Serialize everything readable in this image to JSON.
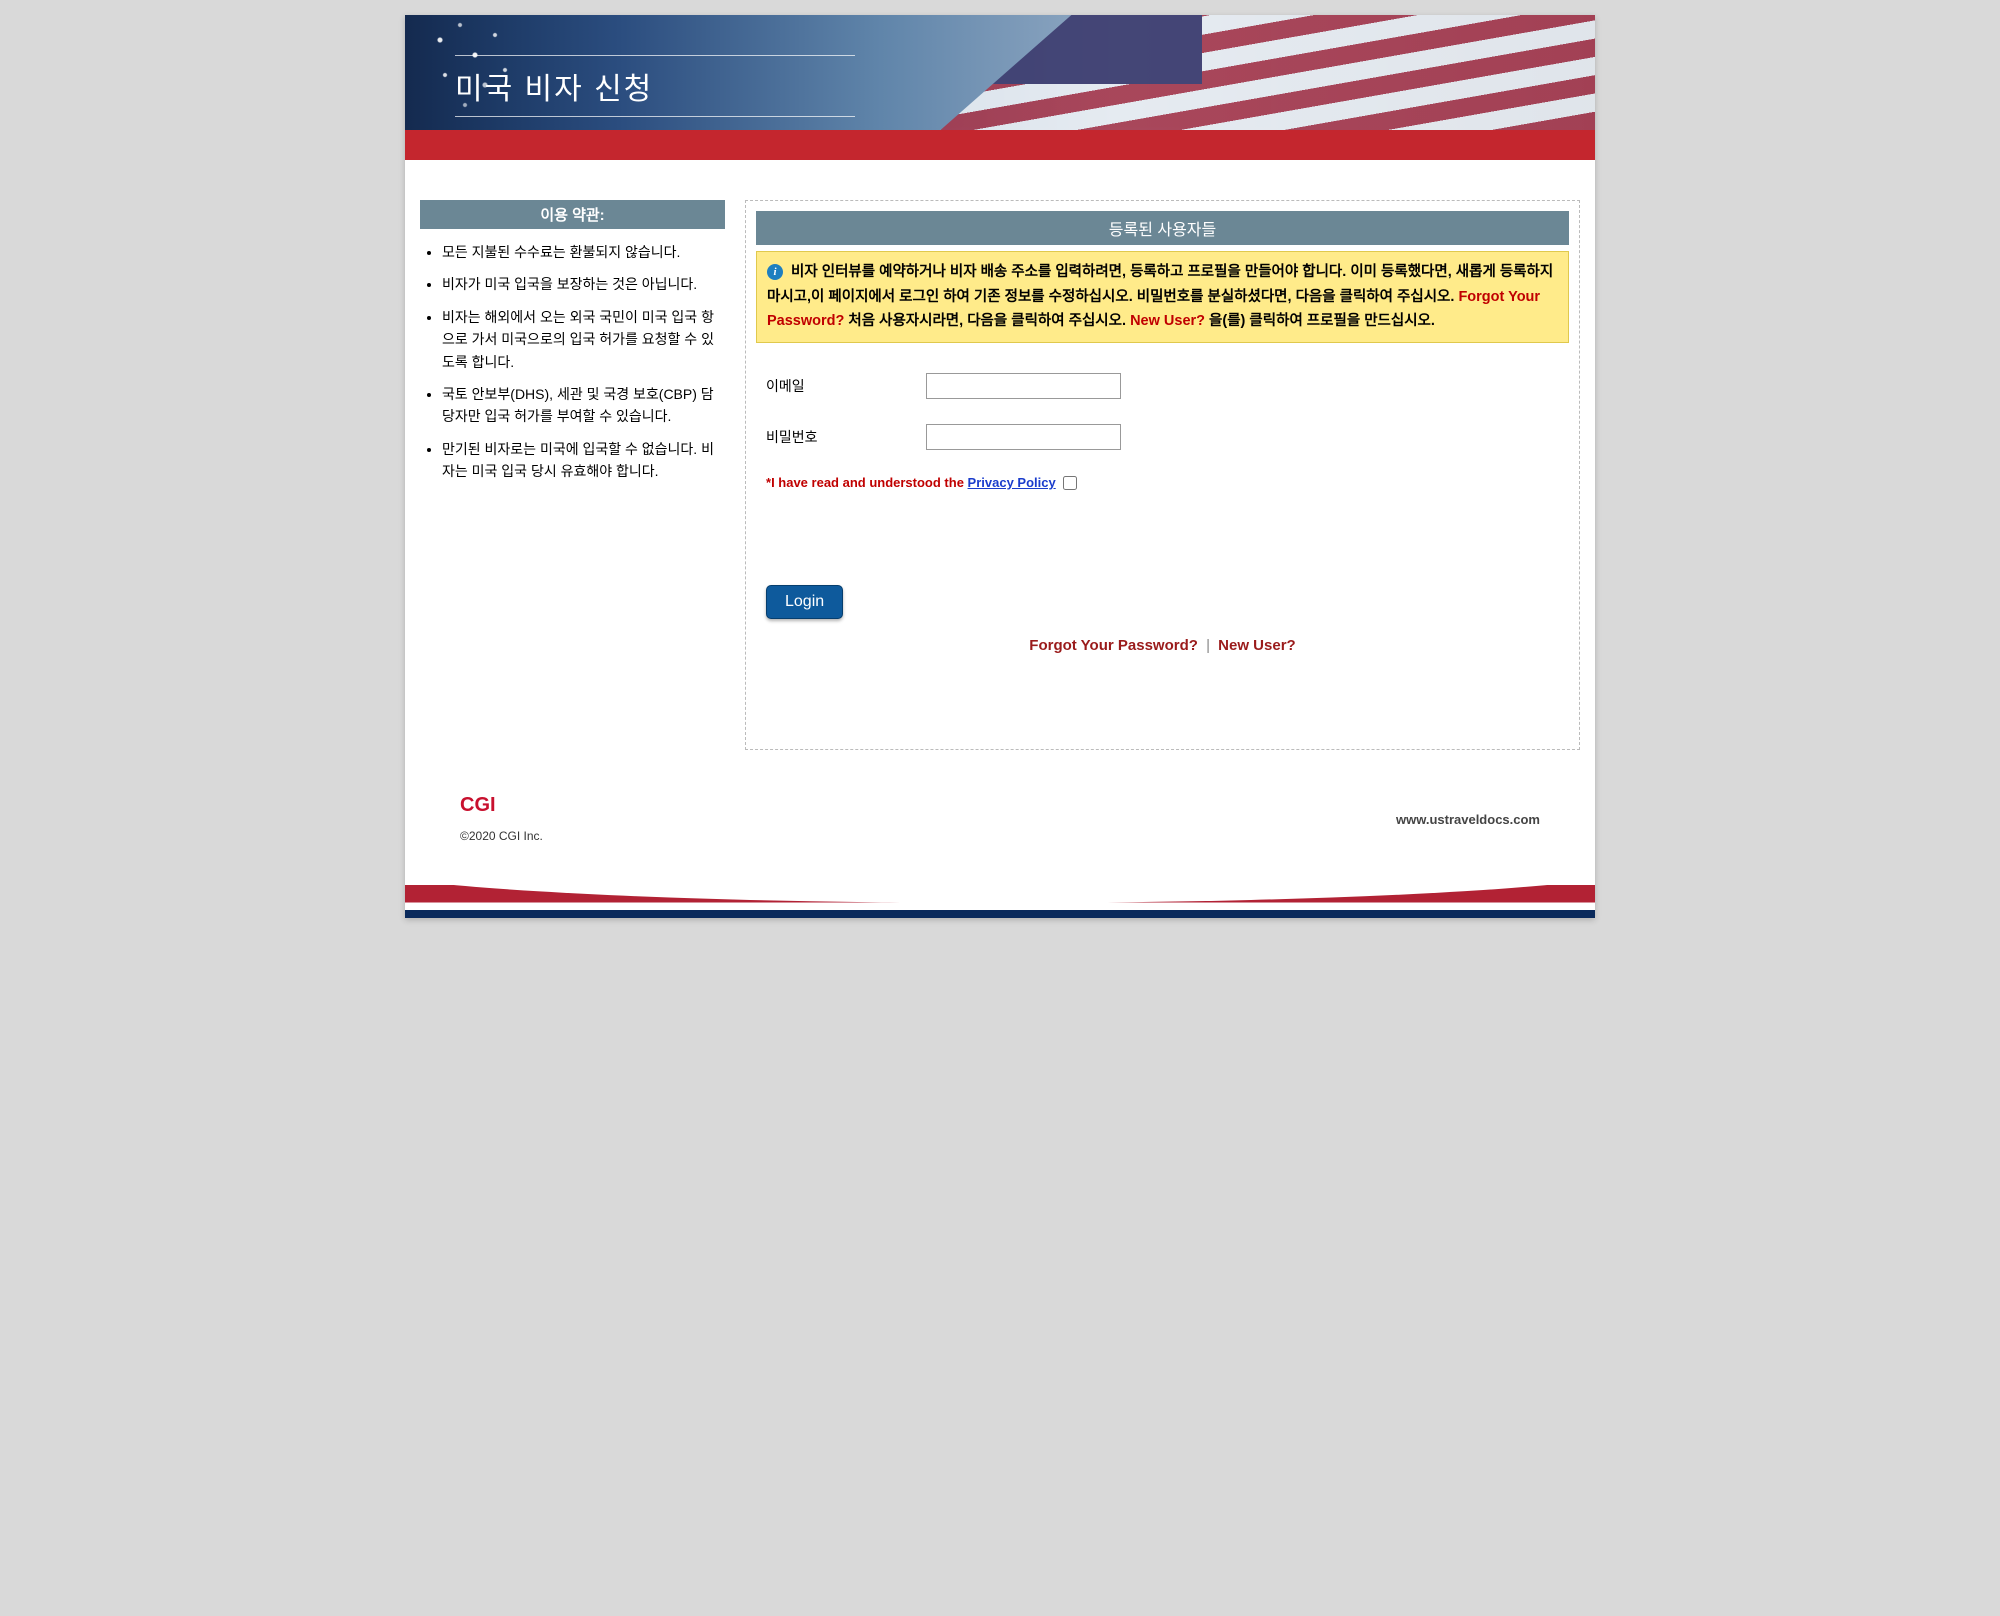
{
  "banner": {
    "title": "미국 비자 신청"
  },
  "sidebar": {
    "header": "이용 약관:",
    "terms": [
      "모든 지불된 수수료는 환불되지 않습니다.",
      "비자가 미국 입국을 보장하는 것은 아닙니다.",
      "비자는 해외에서 오는 외국 국민이 미국 입국 항으로 가서 미국으로의 입국 허가를 요청할 수 있도록 합니다.",
      "국토 안보부(DHS), 세관 및 국경 보호(CBP) 담당자만 입국 허가를 부여할 수 있습니다.",
      "만기된 비자로는 미국에 입국할 수 없습니다. 비자는 미국 입국 당시 유효해야 합니다."
    ]
  },
  "panel": {
    "header": "등록된 사용자들",
    "info_pre": "비자 인터뷰를 예약하거나 비자 배송 주소를 입력하려면, 등록하고 프로필을 만들어야 합니다. 이미 등록했다면, 새롭게 등록하지 마시고,이 페이지에서 로그인 하여 기존 정보를 수정하십시오. 비밀번호를 분실하셨다면, 다음을 클릭하여 주십시오. ",
    "info_forgot": "Forgot Your Password?",
    "info_mid": " 처음 사용자시라면, 다음을 클릭하여 주십시오. ",
    "info_newuser": "New User?",
    "info_post1": "  을(를) ",
    "info_post2": "클릭하여 프로필을 만드십시오."
  },
  "form": {
    "email_label": "이메일",
    "email_value": "",
    "password_label": "비밀번호",
    "password_value": "",
    "privacy_star": "*",
    "privacy_text": "I have read and understood the ",
    "privacy_link": "Privacy Policy",
    "login_button": "Login"
  },
  "links": {
    "forgot": "Forgot Your Password?",
    "sep": "|",
    "newuser": "New User?"
  },
  "footer": {
    "logo": "CGI",
    "copyright": "©2020 CGI Inc.",
    "url": "www.ustraveldocs.com"
  }
}
